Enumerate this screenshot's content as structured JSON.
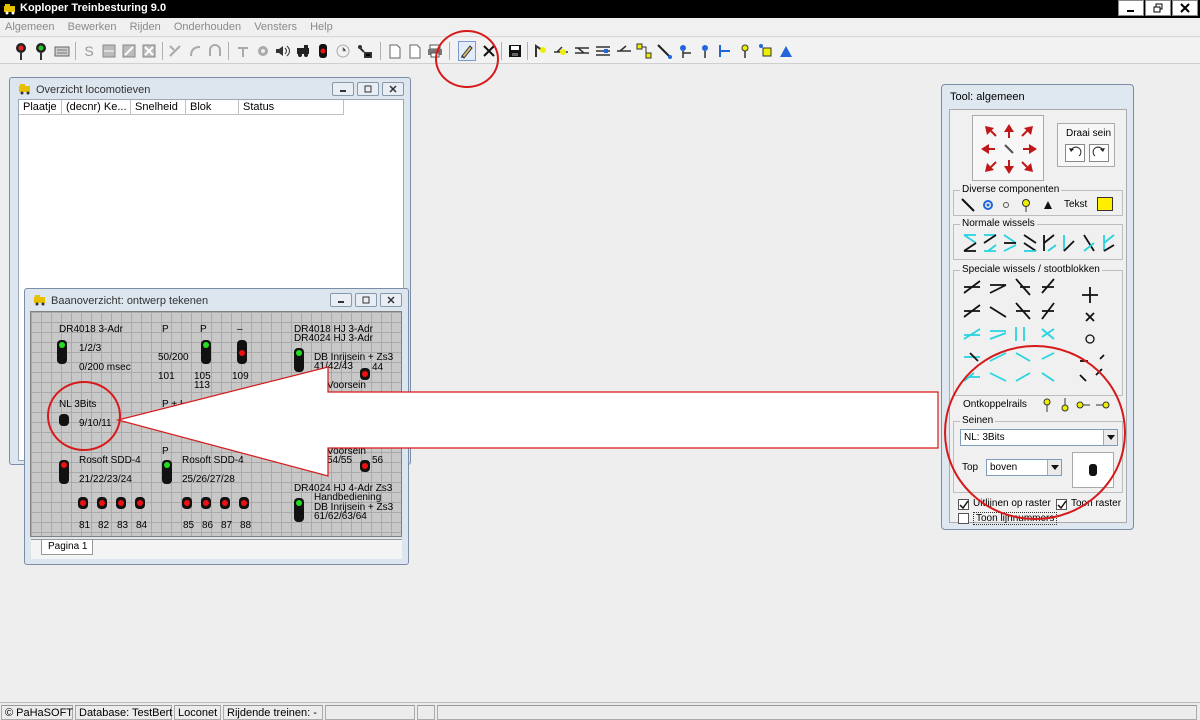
{
  "app": {
    "title": "Koploper Treinbesturing 9.0"
  },
  "menu": [
    "Algemeen",
    "Bewerken",
    "Rijden",
    "Onderhouden",
    "Vensters",
    "Help"
  ],
  "loco_window": {
    "title": "Overzicht locomotieven",
    "columns": [
      "Plaatje",
      "(decnr) Ke...",
      "Snelheid",
      "Blok",
      "Status"
    ]
  },
  "track_window": {
    "title": "Baanoverzicht: ontwerp tekenen",
    "tab": "Pagina 1",
    "labels": {
      "dr4018": "DR4018 3-Adr",
      "addr123": "1/2/3",
      "msec": "0/200 msec",
      "p1": "P",
      "p2": "P",
      "dash": "–",
      "v50": "50/200",
      "v101": "101",
      "v105": "105",
      "v113": "113",
      "v109": "109",
      "dr4018hj": "DR4018 HJ 3-Adr",
      "dr4024hj": "DR4024 HJ 3-Adr",
      "dbin": "DB Inrijsein + Zs3",
      "v41": "41/42/43",
      "v44": "44",
      "voorsein1": "Voorsein",
      "nl3bits": "NL 3Bits",
      "v9": "9/10/11",
      "pplus": "P + I",
      "voorsein2": "Voorsein",
      "v54": "54/55",
      "v56": "56",
      "rosoft1": "Rosoft SDD-4",
      "v21": "21/22/23/24",
      "p3": "P",
      "rosoft2": "Rosoft SDD-4",
      "v25": "25/26/27/28",
      "dr4024zs3": "DR4024 HJ 4-Adr Zs3",
      "handbed": "Handbediening",
      "dbin2": "DB Inrijsein + Zs3",
      "v61": "61/62/63/64",
      "n81": "81",
      "n82": "82",
      "n83": "83",
      "n84": "84",
      "n85": "85",
      "n86": "86",
      "n87": "87",
      "n88": "88"
    }
  },
  "tool_window": {
    "title": "Tool: algemeen",
    "draai_sein": "Draai sein",
    "diverse_label": "Diverse componenten",
    "tekst_label": "Tekst",
    "normale_label": "Normale wissels",
    "speciale_label": "Speciale wissels / stootblokken",
    "ontkoppel_label": "Ontkoppelrails",
    "seinen_label": "Seinen",
    "sein_type": "NL: 3Bits",
    "top_label": "Top",
    "top_value": "boven",
    "uitlijnen": "Uitlijnen op raster",
    "toon_raster": "Toon raster",
    "toon_lijnnummers": "Toon lijnnummers"
  },
  "status": {
    "copyright": "© PaHaSOFT",
    "database": "Database: TestBert",
    "loconet": "Loconet",
    "rijdende": "Rijdende treinen: -"
  },
  "colors": {
    "accent_red": "#d61a1a",
    "cyan": "#27d3e0",
    "arrow_red": "#c01818",
    "yellow": "#ffee00"
  }
}
